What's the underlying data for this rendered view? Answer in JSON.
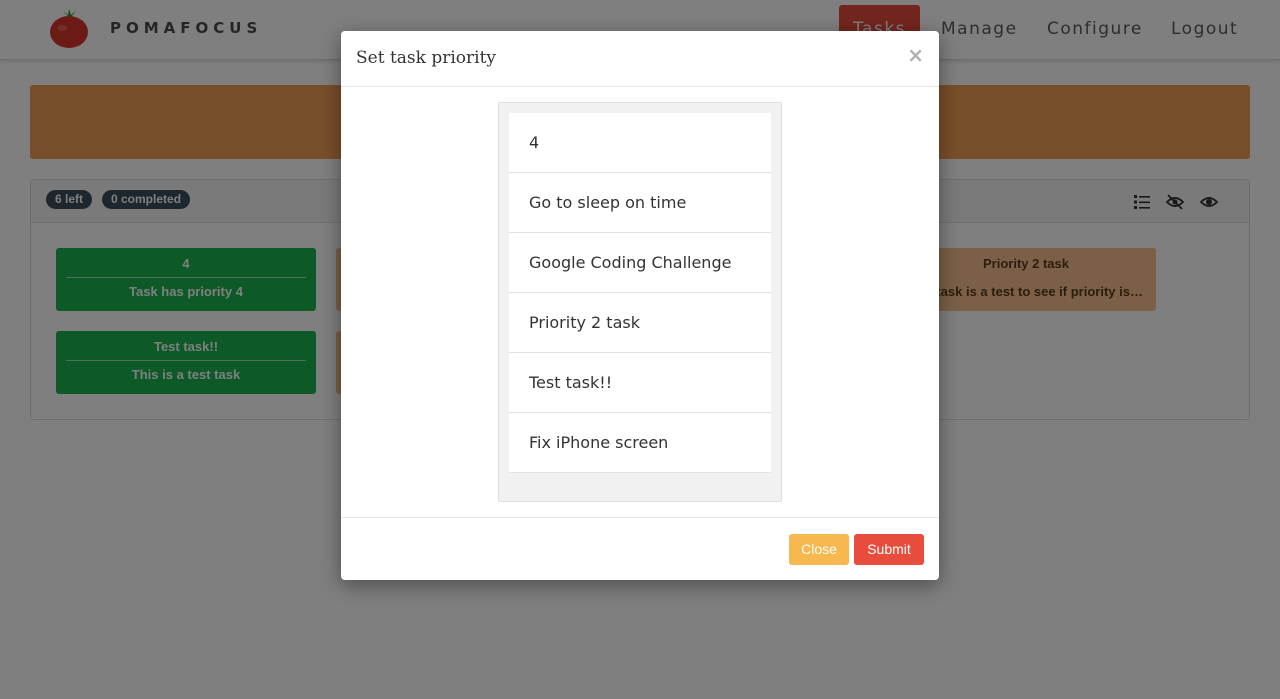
{
  "navbar": {
    "brand": "POMAFOCUS",
    "items": [
      {
        "label": "Tasks",
        "active": true
      },
      {
        "label": "Manage"
      },
      {
        "label": "Configure"
      },
      {
        "label": "Logout"
      }
    ],
    "active_color": "#e74c3c"
  },
  "panel": {
    "left_badge": "6 left",
    "completed_badge": "0 completed",
    "tools": [
      "list-icon",
      "eye-slash-icon",
      "eye-icon"
    ]
  },
  "cards": [
    {
      "title": "4",
      "desc": "Task has priority 4"
    },
    {
      "title": "Test task!!",
      "desc": "This is a test task"
    },
    {
      "title": "Priority 2 task",
      "desc": "This task is a test to see if priority is s..."
    }
  ],
  "modal": {
    "title": "Set task priority",
    "close_symbol": "×",
    "items": [
      "4",
      "Go to sleep on time",
      "Google Coding Challenge",
      "Priority 2 task",
      "Test task!!",
      "Fix iPhone screen"
    ],
    "close_button": "Close",
    "submit_button": "Submit"
  },
  "colors": {
    "green_card": "#1bb24e",
    "orange_card": "#f6c08e",
    "banner": "#f39c55",
    "close_button": "#f7b84f",
    "submit_button": "#e74c3c",
    "badge": "#3c4d5c"
  }
}
